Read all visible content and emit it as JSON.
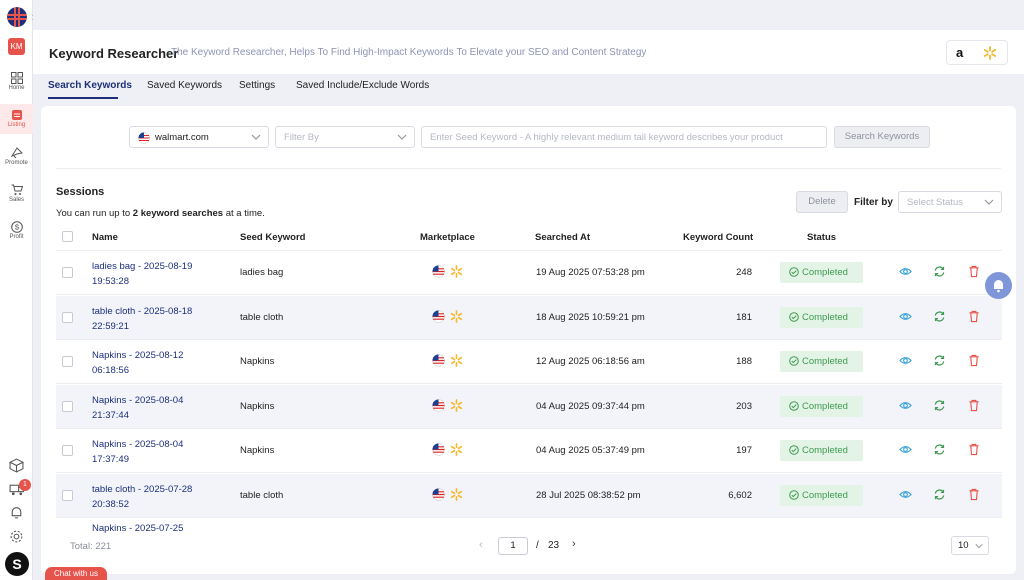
{
  "app": {
    "title": "Keyword Researcher",
    "subtitle": "The Keyword Researcher, Helps To Find High-Impact Keywords To Elevate your SEO and Content Strategy",
    "avatar_initials": "KM",
    "collapse_glyph": "»",
    "chat_label": "Chat with us",
    "notification_count": "1",
    "logo_letter": "S",
    "amazon_glyph": "a"
  },
  "sidebar": {
    "items": [
      {
        "label": "Home",
        "icon": "grid-icon"
      },
      {
        "label": "Listing",
        "icon": "listing-icon",
        "active": true
      },
      {
        "label": "Promote",
        "icon": "promote-icon"
      },
      {
        "label": "Sales",
        "icon": "cart-icon"
      },
      {
        "label": "Profit",
        "icon": "dollar-icon"
      }
    ],
    "bottom_icons": [
      "box-icon",
      "truck-icon",
      "bell-icon",
      "gear-icon"
    ]
  },
  "tabs": [
    {
      "label": "Search Keywords",
      "active": true
    },
    {
      "label": "Saved Keywords"
    },
    {
      "label": "Settings"
    },
    {
      "label": "Saved Include/Exclude Words"
    }
  ],
  "search": {
    "marketplace": "walmart.com",
    "filter_placeholder": "Filter By",
    "seed_placeholder": "Enter Seed Keyword - A highly relevant medium tail keyword describes your product",
    "search_button": "Search Keywords"
  },
  "sessions": {
    "title": "Sessions",
    "info_prefix": "You can run up to ",
    "info_bold": "2 keyword searches",
    "info_suffix": " at a time.",
    "delete_button": "Delete",
    "filter_label": "Filter by",
    "status_placeholder": "Select Status"
  },
  "table": {
    "columns": [
      "Name",
      "Seed Keyword",
      "Marketplace",
      "Searched At",
      "Keyword Count",
      "Status"
    ],
    "rows": [
      {
        "name": "ladies bag - 2025-08-19 19:53:28",
        "seed": "ladies bag",
        "searched_at": "19 Aug 2025 07:53:28 pm",
        "count": "248",
        "status": "Completed"
      },
      {
        "name": "table cloth - 2025-08-18 22:59:21",
        "seed": "table cloth",
        "searched_at": "18 Aug 2025 10:59:21 pm",
        "count": "181",
        "status": "Completed"
      },
      {
        "name": "Napkins - 2025-08-12 06:18:56",
        "seed": "Napkins",
        "searched_at": "12 Aug 2025 06:18:56 am",
        "count": "188",
        "status": "Completed"
      },
      {
        "name": "Napkins - 2025-08-04 21:37:44",
        "seed": "Napkins",
        "searched_at": "04 Aug 2025 09:37:44 pm",
        "count": "203",
        "status": "Completed"
      },
      {
        "name": "Napkins - 2025-08-04 17:37:49",
        "seed": "Napkins",
        "searched_at": "04 Aug 2025 05:37:49 pm",
        "count": "197",
        "status": "Completed"
      },
      {
        "name": "table cloth - 2025-07-28 20:38:52",
        "seed": "table cloth",
        "searched_at": "28 Jul 2025 08:38:52 pm",
        "count": "6,602",
        "status": "Completed"
      },
      {
        "name": "Napkins - 2025-07-25",
        "seed": "",
        "searched_at": "",
        "count": "",
        "status": ""
      }
    ]
  },
  "pagination": {
    "total": "Total: 221",
    "current_page": "1",
    "separator": "/",
    "total_pages": "23",
    "page_size": "10",
    "prev_glyph": "‹",
    "next_glyph": "›"
  },
  "colors": {
    "accent": "#1d2f7a",
    "brand_red": "#e5534b",
    "success": "#3f9a52",
    "success_bg": "#e3f4e6"
  }
}
